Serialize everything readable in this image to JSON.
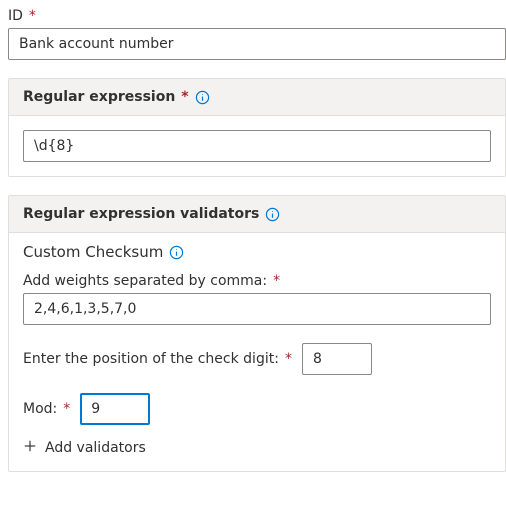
{
  "id": {
    "label": "ID",
    "value": "Bank account number"
  },
  "regex": {
    "header": "Regular expression",
    "value": "\\d{8}"
  },
  "validators": {
    "header": "Regular expression validators",
    "custom": "Custom Checksum",
    "weights_label": "Add weights separated by comma:",
    "weights_value": "2,4,6,1,3,5,7,0",
    "position_label": "Enter the position of the check digit:",
    "position_value": "8",
    "mod_label": "Mod:",
    "mod_value": "9",
    "add_label": "Add validators"
  }
}
